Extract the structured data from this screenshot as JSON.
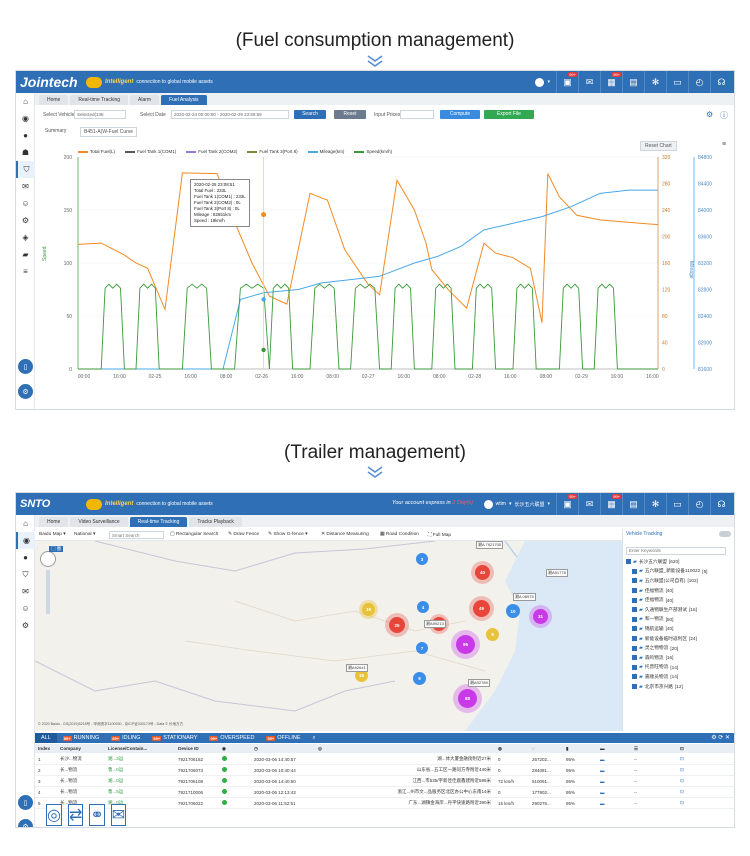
{
  "captions": {
    "top": "(Fuel consumption management)",
    "bottom": "(Trailer management)"
  },
  "fuel": {
    "logo": "Jointech",
    "tagline_strong": "Intelligent",
    "tagline": "connection to global mobile assets",
    "badges": {
      "b1": "99+",
      "b2": "99+"
    },
    "tabs": [
      "Home",
      "Real-time Tracking",
      "Alarm",
      "Fuel Analysis"
    ],
    "toolbar": {
      "select_vehicle_label": "Select Vehicle",
      "selected": "Selected(138",
      "select_date_label": "Select Date",
      "date_from": "2020-02-24 00:00:00",
      "date_sep": "-",
      "date_to": "2020-02-29 23:59:59",
      "search": "Search",
      "reset": "Reset",
      "input_prices": "Input Prices",
      "compute": "Compute",
      "export": "Export File"
    },
    "subtabs": {
      "summary": "Summary",
      "curve": "B451-A(W-Fuel Curve"
    },
    "reset_chart": "Reset Chart",
    "axis_left_label": "Speed",
    "axis_right_label": "Mileage",
    "tooltip": [
      "2020-02-25 23:08:51",
      "Total Fuel : 233L",
      "Fuel Tank 1(COM1) : 233L",
      "Fuel Tank 2(COM2) : 0L",
      "Fuel Tank 3(Port 8) : 0L",
      "Mileage : 82651km",
      "Speed : 18km/h"
    ]
  },
  "chart_data": {
    "type": "line",
    "title": "",
    "x_ticks": [
      "00:00",
      "16:00",
      "02-25",
      "16:00",
      "08:00",
      "02-26",
      "16:00",
      "08:00",
      "02-27",
      "16:00",
      "08:00",
      "02-28",
      "16:00",
      "08:00",
      "02-29",
      "16:00",
      "16:00"
    ],
    "y_left_ticks": [
      0,
      50,
      100,
      150,
      200
    ],
    "y_right1_ticks": [
      0,
      40,
      80,
      120,
      160,
      200,
      240,
      280,
      320
    ],
    "y_right2_ticks": [
      81600,
      82000,
      82400,
      82800,
      83200,
      83600,
      84000,
      84400,
      84800
    ],
    "legend": [
      {
        "name": "Total Fuel(L)",
        "color": "#f08a24"
      },
      {
        "name": "Fuel Tank 1(COM1)",
        "color": "#5a5a5a"
      },
      {
        "name": "Fuel Tank 2(COM2)",
        "color": "#9b7ad6"
      },
      {
        "name": "Fuel Tank 3(Port 8)",
        "color": "#7a8a3a"
      },
      {
        "name": "Mileage(km)",
        "color": "#4aa8e8"
      },
      {
        "name": "Speed(km/h)",
        "color": "#3a9a3a"
      }
    ],
    "series": [
      {
        "name": "Total Fuel(L)",
        "ylim": [
          0,
          320
        ],
        "x": [
          0,
          0.04,
          0.08,
          0.1,
          0.12,
          0.15,
          0.18,
          0.24,
          0.27,
          0.3,
          0.33,
          0.36,
          0.4,
          0.43,
          0.46,
          0.5,
          0.52,
          0.55,
          0.58,
          0.6,
          0.61,
          0.64,
          0.67,
          0.7,
          0.72,
          0.75,
          0.78,
          0.8,
          0.81,
          0.83,
          0.86,
          0.9,
          0.94,
          1
        ],
        "y": [
          188,
          190,
          172,
          160,
          152,
          90,
          296,
          295,
          222,
          160,
          110,
          98,
          265,
          255,
          180,
          128,
          112,
          285,
          240,
          190,
          150,
          118,
          92,
          190,
          175,
          168,
          152,
          70,
          295,
          260,
          232,
          225,
          222,
          218
        ]
      },
      {
        "name": "Mileage(km)",
        "ylim": [
          81600,
          84800
        ],
        "x": [
          0,
          0.12,
          0.18,
          0.25,
          0.28,
          0.32,
          0.38,
          0.42,
          0.47,
          0.52,
          0.58,
          0.62,
          0.66,
          0.7,
          0.75,
          0.8,
          0.85,
          0.9,
          0.95,
          1
        ],
        "y": [
          81600,
          81600,
          81600,
          81600,
          82650,
          82750,
          82800,
          82900,
          82950,
          83000,
          83200,
          83300,
          83450,
          83700,
          83800,
          83900,
          84050,
          84250,
          84300,
          84300
        ]
      },
      {
        "name": "Speed(km/h)",
        "ylim": [
          0,
          200
        ],
        "bursts": [
          [
            0.04,
            0.08
          ],
          [
            0.1,
            0.14
          ],
          [
            0.18,
            0.23
          ],
          [
            0.27,
            0.33
          ],
          [
            0.33,
            0.37
          ],
          [
            0.4,
            0.45
          ],
          [
            0.47,
            0.52
          ],
          [
            0.54,
            0.58
          ],
          [
            0.61,
            0.65
          ],
          [
            0.68,
            0.72
          ],
          [
            0.75,
            0.79
          ],
          [
            0.83,
            0.87
          ],
          [
            0.89,
            0.93
          ]
        ],
        "peak": 80
      }
    ]
  },
  "trailer": {
    "logo": "SNTO",
    "tagline_strong": "Intelligent",
    "tagline": "connection to global mobile assets",
    "expiry": "Your account express in",
    "expiry_days": "2 Day(s)",
    "user": "wtim",
    "badges": {
      "b1": "99+",
      "b2": "99+"
    },
    "tabs": [
      "Home",
      "Video Surveillance",
      "Real-time Tracking",
      "Tracks Playback"
    ],
    "map_tools": {
      "map": "Baidu Map",
      "region": "National",
      "search_placeholder": "Smart Search",
      "rect": "Rectangular Search",
      "fence": "Draw Fence",
      "gfence": "Show G-fence",
      "distance": "Distance Measuring",
      "road": "Road Condition",
      "full": "Full Map"
    },
    "vehicle_tracking": "Vehicle Tracking",
    "enter_keywords": "Enter Keywords",
    "tree": [
      {
        "label": "长沙五六联盟",
        "count": "[620]"
      },
      {
        "label": "五六联盟_新能设备110022",
        "count": "[5]"
      },
      {
        "label": "五六联盟(公司自有)",
        "count": "[102]"
      },
      {
        "label": "佳福物流",
        "count": "[40]"
      },
      {
        "label": "佳福物流",
        "count": "[40]"
      },
      {
        "label": "久通物联生产部测试",
        "count": "[16]"
      },
      {
        "label": "和一物流",
        "count": "[50]"
      },
      {
        "label": "锦航运输",
        "count": "[40]"
      },
      {
        "label": "新能设备临时返利区",
        "count": "[24]"
      },
      {
        "label": "灵之物物流",
        "count": "[20]"
      },
      {
        "label": "森鸣物流",
        "count": "[16]"
      },
      {
        "label": "托普旺物流",
        "count": "[14]"
      },
      {
        "label": "嘉顺员物流",
        "count": "[14]"
      },
      {
        "label": "北京市京兴路",
        "count": "[12]"
      }
    ],
    "status_tabs": [
      {
        "label": "ALL",
        "badge": ""
      },
      {
        "label": "RUNNING",
        "badge": "99+"
      },
      {
        "label": "IDLING",
        "badge": "99+"
      },
      {
        "label": "STATIONARY",
        "badge": "99+"
      },
      {
        "label": "OVERSPEED",
        "badge": "99+"
      },
      {
        "label": "OFFLINE",
        "badge": "99+"
      }
    ],
    "columns": [
      "Index",
      "Company",
      "License/Contain...",
      "Device ID",
      "",
      "",
      "",
      "",
      "",
      "",
      "",
      "",
      "",
      ""
    ],
    "rows": [
      {
        "idx": "1",
        "company": "长沙...物流",
        "license": "湘...3运",
        "device": "7921706162",
        "time": "2020-03-06 14:40:57",
        "addr": "湖...体大厦金融街附近27米",
        "speed": "0",
        "mil": "267202...",
        "pct": "95%",
        "extra": "--"
      },
      {
        "idx": "2",
        "company": "长...物流",
        "license": "鲁...0运",
        "device": "7921706073",
        "time": "2020-03-06 10:40:44",
        "addr": "山东省...五工区一路同方寺附近440米",
        "speed": "0",
        "mil": "284081...",
        "pct": "95%",
        "extra": "--"
      },
      {
        "idx": "3",
        "company": "长...物流",
        "license": "湘...0运",
        "device": "7921706108",
        "time": "2020-03-06 14:40:50",
        "addr": "江西...市535/宇新佳佳鹿鑫建附近595米",
        "speed": "72 km/h",
        "mil": "510091...",
        "pct": "95%",
        "extra": "--"
      },
      {
        "idx": "4",
        "company": "长...物流",
        "license": "鲁...5运",
        "device": "7921710006",
        "time": "2020-03-06 12:13:43",
        "addr": "浙江...州市文...品服务区北区办公中心东南14米",
        "speed": "0",
        "mil": "177902...",
        "pct": "95%",
        "extra": "--"
      },
      {
        "idx": "5",
        "company": "长...物流",
        "license": "湘...0运",
        "device": "7921706022",
        "time": "2020-03-06 11:52:51",
        "addr": "广东...湖镇金海岸...丹平快速路附近390米",
        "speed": "15 km/h",
        "mil": "290276...",
        "pct": "95%",
        "extra": "--"
      }
    ],
    "map_footer": "© 2020 Baidu - GS(2019)5218号 - 甲测资字1100930 - 京ICP证030173号 - Data © 长地万方"
  }
}
